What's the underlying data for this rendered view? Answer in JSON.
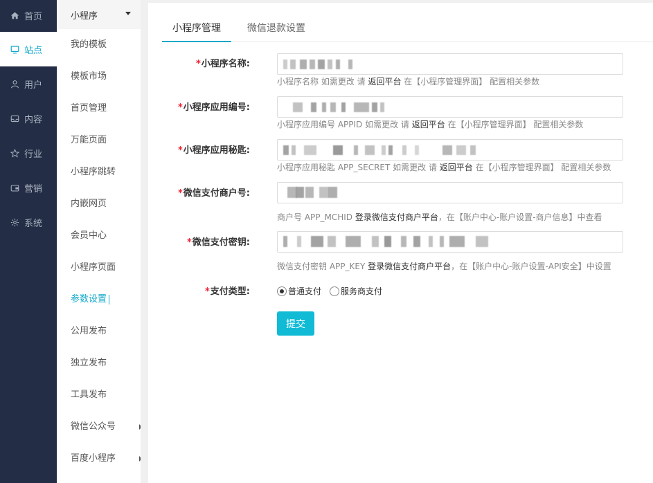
{
  "rail": {
    "items": [
      {
        "label": "首页",
        "icon": "home-icon"
      },
      {
        "label": "站点",
        "icon": "monitor-icon"
      },
      {
        "label": "用户",
        "icon": "user-icon"
      },
      {
        "label": "内容",
        "icon": "inbox-icon"
      },
      {
        "label": "行业",
        "icon": "star-icon"
      },
      {
        "label": "营销",
        "icon": "wallet-icon"
      },
      {
        "label": "系统",
        "icon": "gear-icon"
      }
    ],
    "active_index": 1
  },
  "subnav": {
    "header": "小程序",
    "items": [
      {
        "label": "我的模板"
      },
      {
        "label": "模板市场"
      },
      {
        "label": "首页管理"
      },
      {
        "label": "万能页面"
      },
      {
        "label": "小程序跳转"
      },
      {
        "label": "内嵌网页"
      },
      {
        "label": "会员中心"
      },
      {
        "label": "小程序页面"
      },
      {
        "label": "参数设置"
      },
      {
        "label": "公用发布"
      },
      {
        "label": "独立发布"
      },
      {
        "label": "工具发布"
      },
      {
        "label": "微信公众号"
      },
      {
        "label": "百度小程序"
      }
    ],
    "active_index": 8
  },
  "tabs": [
    {
      "label": "小程序管理"
    },
    {
      "label": "微信退款设置"
    }
  ],
  "form": {
    "fields": [
      {
        "label": "小程序名称:",
        "help_pre": "小程序名称 如需更改 请 ",
        "help_link": "返回平台",
        "help_post": " 在【小程序管理界面】 配置相关参数"
      },
      {
        "label": "小程序应用编号:",
        "help_pre": "小程序应用编号 APPID 如需更改 请 ",
        "help_link": "返回平台",
        "help_post": " 在【小程序管理界面】 配置相关参数"
      },
      {
        "label": "小程序应用秘匙:",
        "help_pre": "小程序应用秘匙 APP_SECRET 如需更改 请 ",
        "help_link": "返回平台",
        "help_post": " 在【小程序管理界面】 配置相关参数"
      },
      {
        "label": "微信支付商户号:",
        "help_pre": "商户号 APP_MCHID ",
        "help_link": "登录微信支付商户平台",
        "help_post": "，在【账户中心-账户设置-商户信息】中查看"
      },
      {
        "label": "微信支付密钥:",
        "help_pre": "微信支付密钥 APP_KEY ",
        "help_link": "登录微信支付商户平台",
        "help_post": "，在【账户中心-账户设置-API安全】中设置"
      }
    ],
    "pay_type": {
      "label": "支付类型:",
      "options": [
        {
          "label": "普通支付",
          "checked": true
        },
        {
          "label": "服务商支付",
          "checked": false
        }
      ]
    },
    "submit_label": "提交"
  },
  "colors": {
    "accent": "#11a8c9",
    "button": "#11bbd6",
    "rail_bg": "#232d45",
    "required": "#ee2233"
  }
}
